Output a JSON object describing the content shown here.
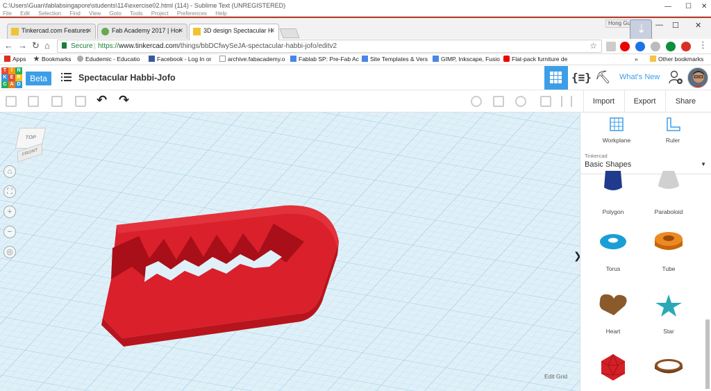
{
  "sublime": {
    "title": "C:\\Users\\Guan\\fablabsingapore\\students\\114\\exercise02.html (114) - Sublime Text (UNREGISTERED)",
    "menu": "File Edit Selection Find View Goto Tools Project Preferences Help",
    "controls": {
      "minimize": "—",
      "maximize": "☐",
      "close": "✕"
    }
  },
  "browser": {
    "tabs": [
      {
        "label": "Tinkercad.com Features",
        "favicon_color": "#f1c232"
      },
      {
        "label": "Fab Academy 2017 | Hor",
        "favicon_color": "#6aa84f"
      },
      {
        "label": "3D design Spectacular H",
        "favicon_color": "#f1c232"
      }
    ],
    "user_label": "Hong Guan",
    "window_controls": {
      "minimize": "—",
      "maximize": "☐",
      "close": "✕"
    },
    "secure_label": "Secure",
    "url_scheme": "https://",
    "url_host": "www.tinkercad.com",
    "url_path": "/things/bbDCfwySeJA-spectacular-habbi-jofo/editv2",
    "bookmarks": [
      {
        "label": "Apps",
        "color": "#777"
      },
      {
        "label": "Bookmarks",
        "color": "#444"
      },
      {
        "label": "Edudemic - Educatio",
        "color": "#aaa"
      },
      {
        "label": "Facebook - Log In or",
        "color": "#3b5998"
      },
      {
        "label": "archive.fabacademy.o",
        "color": "#aaa"
      },
      {
        "label": "Fablab SP: Pre-Fab Ac",
        "color": "#4a86e8"
      },
      {
        "label": "Site Templates & Vers",
        "color": "#4a86e8"
      },
      {
        "label": "GIMP, Inkscape, Fusio",
        "color": "#4a86e8"
      },
      {
        "label": "Flat-pack furniture de",
        "color": "#e00"
      }
    ],
    "bookmarks_more": "»",
    "other_bookmarks": "Other bookmarks"
  },
  "tinkercad": {
    "logo_letters": [
      "T",
      "I",
      "N",
      "K",
      "E",
      "R",
      "C",
      "A",
      "D"
    ],
    "beta_label": "Beta",
    "design_name": "Spectacular Habbi-Jofo",
    "whats_new": "What's New",
    "code_icon": "{≡}",
    "pick_icon": "⛏",
    "toolbar": {
      "import": "Import",
      "export": "Export",
      "share": "Share",
      "undo": "↶",
      "redo": "↷"
    },
    "viewcube": {
      "top": "TOP",
      "front": "FRONT"
    },
    "view_buttons": [
      "⌂",
      "⛶",
      "+",
      "−",
      "◎"
    ],
    "edit_grid": "Edit Grid",
    "panel": {
      "workplane": "Workplane",
      "ruler": "Ruler",
      "library_source": "Tinkercad",
      "library": "Basic Shapes",
      "shapes": [
        "Polygon",
        "Paraboloid",
        "Torus",
        "Tube",
        "Heart",
        "Star",
        "",
        ""
      ],
      "collapse": "❯"
    }
  }
}
